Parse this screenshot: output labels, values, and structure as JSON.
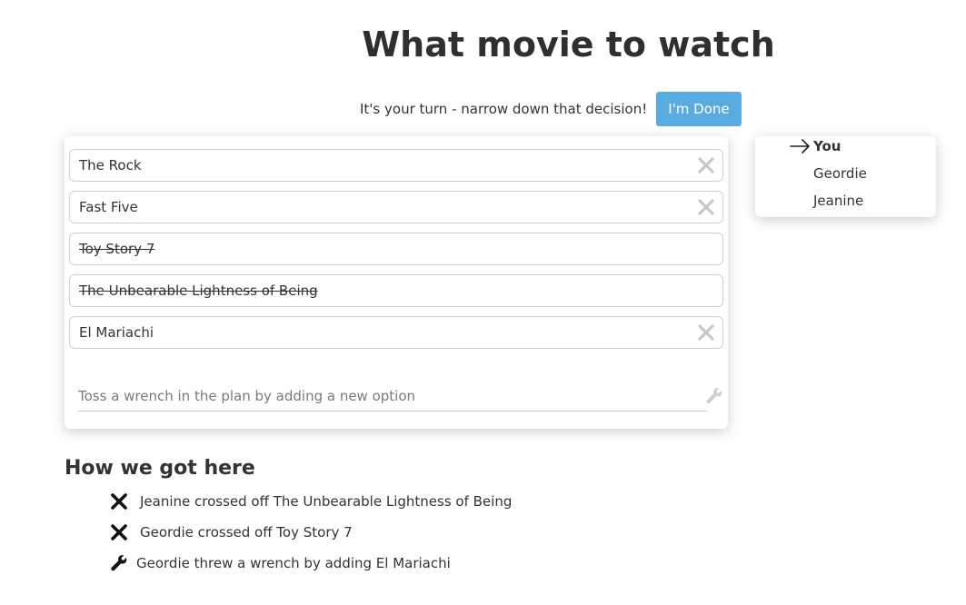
{
  "header": {
    "title": "What movie to watch"
  },
  "turn": {
    "prompt": "It's your turn - narrow down that decision!",
    "done_label": "I'm Done"
  },
  "options": [
    {
      "label": "The Rock",
      "crossed": false
    },
    {
      "label": "Fast Five",
      "crossed": false
    },
    {
      "label": "Toy Story 7",
      "crossed": true
    },
    {
      "label": "The Unbearable Lightness of Being",
      "crossed": true
    },
    {
      "label": "El Mariachi",
      "crossed": false
    }
  ],
  "new_option": {
    "placeholder": "Toss a wrench in the plan by adding a new option",
    "value": ""
  },
  "players": [
    {
      "name": "You",
      "current": true
    },
    {
      "name": "Geordie",
      "current": false
    },
    {
      "name": "Jeanine",
      "current": false
    }
  ],
  "history": {
    "title": "How we got here",
    "items": [
      {
        "icon": "cross-icon",
        "text": "Jeanine crossed off The Unbearable Lightness of Being"
      },
      {
        "icon": "cross-icon",
        "text": "Geordie crossed off Toy Story 7"
      },
      {
        "icon": "wrench-icon",
        "text": "Geordie threw a wrench by adding El Mariachi"
      }
    ]
  },
  "colors": {
    "accent": "#5aace0",
    "text": "#333333",
    "remove_icon": "#c8c8c8"
  }
}
